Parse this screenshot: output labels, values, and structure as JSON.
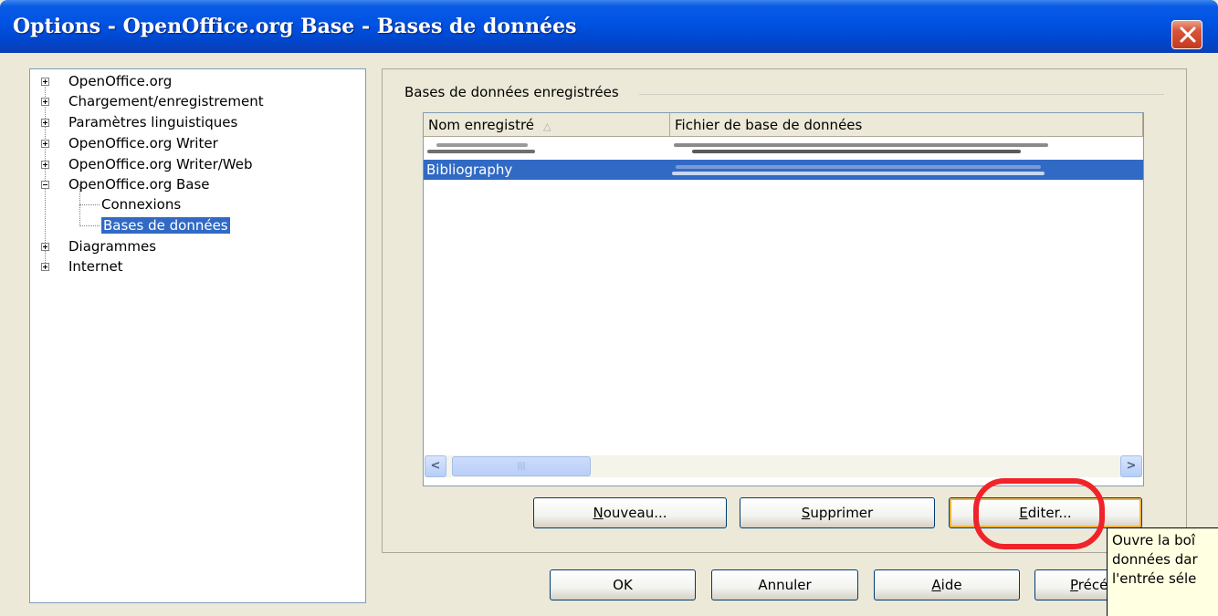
{
  "window": {
    "title": "Options - OpenOffice.org Base - Bases de données",
    "close_icon": "close-x-icon"
  },
  "tree": {
    "items": [
      {
        "label": "OpenOffice.org",
        "expander": "plus"
      },
      {
        "label": "Chargement/enregistrement",
        "expander": "plus"
      },
      {
        "label": "Paramètres linguistiques",
        "expander": "plus"
      },
      {
        "label": "OpenOffice.org Writer",
        "expander": "plus"
      },
      {
        "label": "OpenOffice.org Writer/Web",
        "expander": "plus"
      },
      {
        "label": "OpenOffice.org Base",
        "expander": "minus"
      },
      {
        "label": "Connexions",
        "expander": "none"
      },
      {
        "label": "Bases de données",
        "expander": "none",
        "selected": true
      },
      {
        "label": "Diagrammes",
        "expander": "plus"
      },
      {
        "label": "Internet",
        "expander": "plus"
      }
    ]
  },
  "group": {
    "title": "Bases de données enregistrées"
  },
  "table": {
    "columns": [
      "Nom enregistré",
      "Fichier de base de données"
    ],
    "sort_indicator": "△",
    "rows": [
      {
        "name": "",
        "file": "",
        "selected": false
      },
      {
        "name": "Bibliography",
        "file": "",
        "selected": true
      }
    ]
  },
  "scrollbar": {
    "left_arrow": "<",
    "right_arrow": ">",
    "thumb_grip": "|||"
  },
  "buttons": {
    "new": {
      "underline": "N",
      "rest": "ouveau..."
    },
    "delete": {
      "underline": "S",
      "rest": "upprimer"
    },
    "edit": {
      "underline": "E",
      "rest": "diter..."
    },
    "ok": "OK",
    "cancel": "Annuler",
    "help": {
      "underline": "A",
      "rest": "ide"
    },
    "previous": {
      "underline": "P",
      "rest": "récé"
    }
  },
  "tooltip": {
    "lines": [
      "Ouvre la boî",
      "données dar",
      "l'entrée séle"
    ]
  },
  "colors": {
    "titlebar": "#0054e3",
    "selection": "#316ac5",
    "annotation": "#f0232a",
    "tooltip_bg": "#ffffe1"
  }
}
